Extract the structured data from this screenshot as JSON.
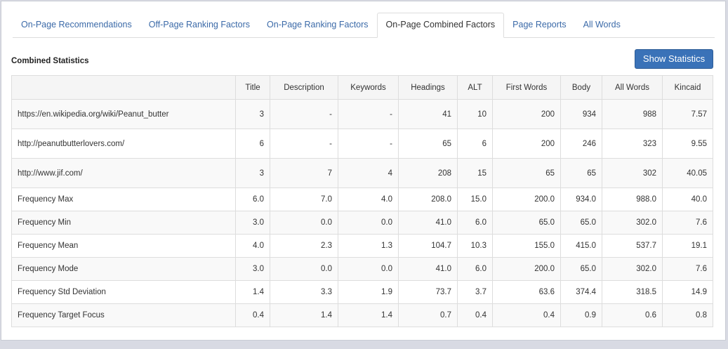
{
  "tabs": [
    {
      "label": "On-Page Recommendations",
      "active": false
    },
    {
      "label": "Off-Page Ranking Factors",
      "active": false
    },
    {
      "label": "On-Page Ranking Factors",
      "active": false
    },
    {
      "label": "On-Page Combined Factors",
      "active": true
    },
    {
      "label": "Page Reports",
      "active": false
    },
    {
      "label": "All Words",
      "active": false
    }
  ],
  "section": {
    "title": "Combined Statistics",
    "show_button_label": "Show Statistics"
  },
  "colors": {
    "link": "#3b6aa8",
    "button": "#3a72b8",
    "header_bg": "#f5f5f5",
    "border": "#dddddd"
  },
  "table": {
    "columns": [
      "",
      "Title",
      "Description",
      "Keywords",
      "Headings",
      "ALT",
      "First Words",
      "Body",
      "All Words",
      "Kincaid"
    ],
    "url_rows": [
      {
        "label": "https://en.wikipedia.org/wiki/Peanut_butter",
        "values": [
          "3",
          "-",
          "-",
          "41",
          "10",
          "200",
          "934",
          "988",
          "7.57"
        ]
      },
      {
        "label": "http://peanutbutterlovers.com/",
        "values": [
          "6",
          "-",
          "-",
          "65",
          "6",
          "200",
          "246",
          "323",
          "9.55"
        ]
      },
      {
        "label": "http://www.jif.com/",
        "values": [
          "3",
          "7",
          "4",
          "208",
          "15",
          "65",
          "65",
          "302",
          "40.05"
        ]
      }
    ],
    "stat_rows": [
      {
        "label": "Frequency Max",
        "values": [
          "6.0",
          "7.0",
          "4.0",
          "208.0",
          "15.0",
          "200.0",
          "934.0",
          "988.0",
          "40.0"
        ]
      },
      {
        "label": "Frequency Min",
        "values": [
          "3.0",
          "0.0",
          "0.0",
          "41.0",
          "6.0",
          "65.0",
          "65.0",
          "302.0",
          "7.6"
        ]
      },
      {
        "label": "Frequency Mean",
        "values": [
          "4.0",
          "2.3",
          "1.3",
          "104.7",
          "10.3",
          "155.0",
          "415.0",
          "537.7",
          "19.1"
        ]
      },
      {
        "label": "Frequency Mode",
        "values": [
          "3.0",
          "0.0",
          "0.0",
          "41.0",
          "6.0",
          "200.0",
          "65.0",
          "302.0",
          "7.6"
        ]
      },
      {
        "label": "Frequency Std Deviation",
        "values": [
          "1.4",
          "3.3",
          "1.9",
          "73.7",
          "3.7",
          "63.6",
          "374.4",
          "318.5",
          "14.9"
        ]
      },
      {
        "label": "Frequency Target Focus",
        "values": [
          "0.4",
          "1.4",
          "1.4",
          "0.7",
          "0.4",
          "0.4",
          "0.9",
          "0.6",
          "0.8"
        ]
      }
    ]
  }
}
